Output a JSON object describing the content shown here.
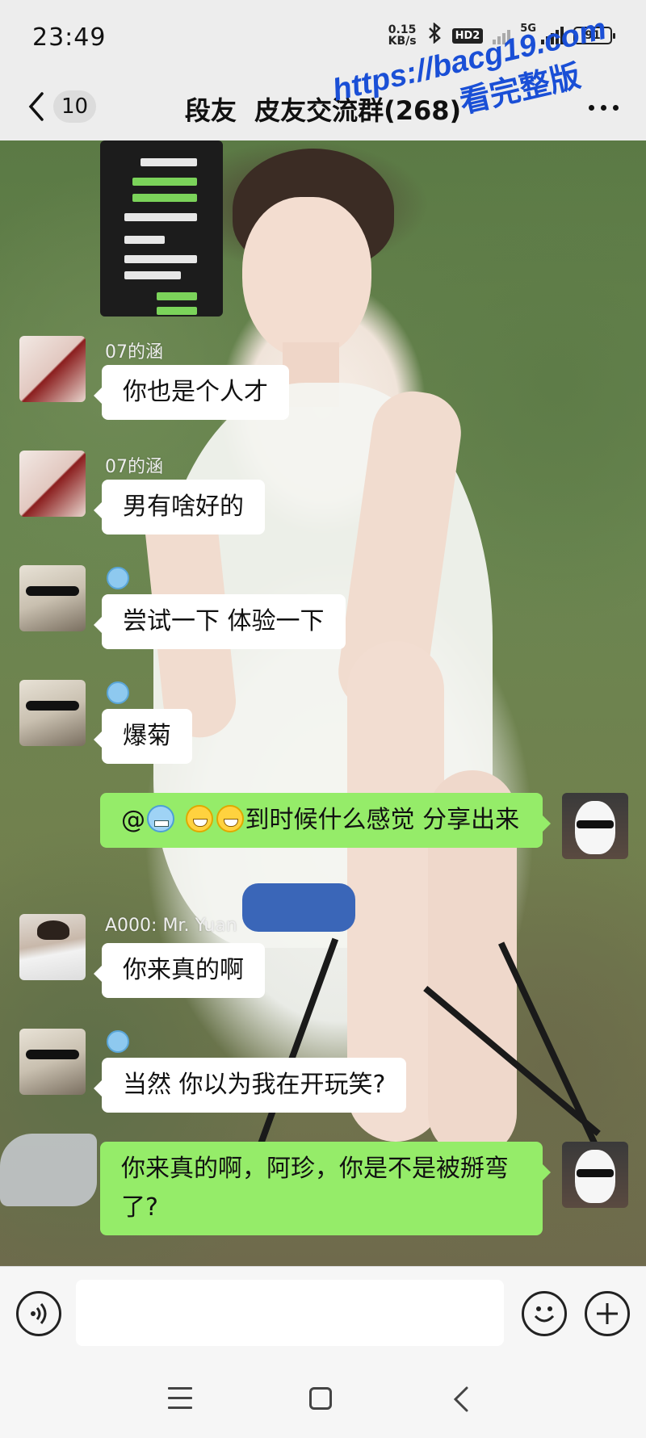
{
  "status": {
    "time": "23:49",
    "net_speed_value": "0.15",
    "net_speed_unit": "KB/s",
    "hd": "HD2",
    "net_type": "5G",
    "battery": "91"
  },
  "header": {
    "unread_count": "10",
    "title": "段友  皮友交流群(268)"
  },
  "watermark": {
    "line1": "https://bacg19.com",
    "line2": "看完整版"
  },
  "messages": [
    {
      "sender": "07的涵",
      "text": "你也是个人才"
    },
    {
      "sender": "07的涵",
      "text": "男有啥好的"
    },
    {
      "sender": "",
      "text": "尝试一下  体验一下"
    },
    {
      "sender": "",
      "text": "爆菊"
    },
    {
      "sender": "",
      "text_prefix": "@",
      "text_body": "到时候什么感觉 分享出来"
    },
    {
      "sender": "A000: Mr. Yuan",
      "text": "你来真的啊"
    },
    {
      "sender": "",
      "text": "当然  你以为我在开玩笑?"
    },
    {
      "sender": "",
      "text": "你来真的啊，阿珍，你是不是被掰弯了?"
    }
  ],
  "input": {
    "placeholder": ""
  },
  "colors": {
    "outgoing_bubble": "#95ec69",
    "incoming_bubble": "#ffffff",
    "watermark": "#1a4fd6",
    "background": "#ededed"
  },
  "icons": [
    "back-icon",
    "more-icon",
    "voice-icon",
    "emoji-icon",
    "plus-icon",
    "nav-menu-icon",
    "nav-home-icon",
    "nav-back-icon"
  ]
}
